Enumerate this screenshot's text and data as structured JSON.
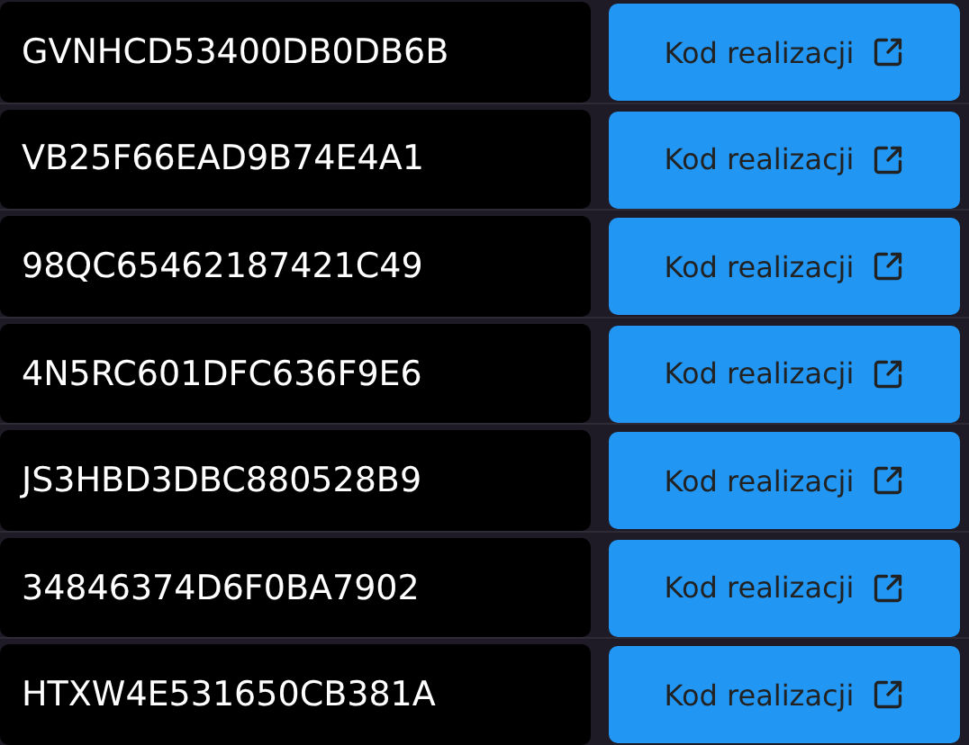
{
  "codes": [
    {
      "code": "GVNHCD53400DB0DB6B",
      "button": "Kod realizacji"
    },
    {
      "code": "VB25F66EAD9B74E4A1",
      "button": "Kod realizacji"
    },
    {
      "code": "98QC65462187421C49",
      "button": "Kod realizacji"
    },
    {
      "code": "4N5RC601DFC636F9E6",
      "button": "Kod realizacji"
    },
    {
      "code": "JS3HBD3DBC880528B9",
      "button": "Kod realizacji"
    },
    {
      "code": "34846374D6F0BA7902",
      "button": "Kod realizacji"
    },
    {
      "code": "HTXW4E531650CB381A",
      "button": "Kod realizacji"
    }
  ]
}
